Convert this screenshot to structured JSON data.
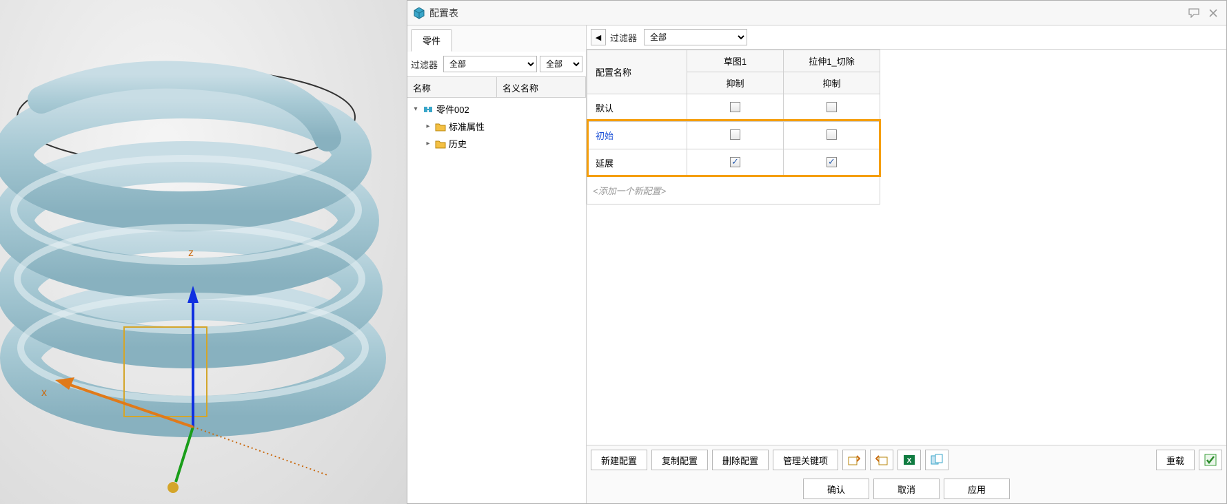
{
  "window": {
    "title": "配置表"
  },
  "left": {
    "tab_label": "零件",
    "filter_label": "过滤器",
    "filter1": "全部",
    "filter2": "全部",
    "header_name": "名称",
    "header_nominal": "名义名称",
    "tree": {
      "root": "零件002",
      "items": [
        "标准属性",
        "历史"
      ]
    }
  },
  "right": {
    "filter_label": "过滤器",
    "filter_value": "全部",
    "grid": {
      "col_config_name": "配置名称",
      "features": [
        {
          "name": "草图1",
          "param": "抑制"
        },
        {
          "name": "拉伸1_切除",
          "param": "抑制"
        }
      ],
      "rows": [
        {
          "name": "默认",
          "link": false,
          "suppress": [
            false,
            false
          ]
        },
        {
          "name": "初始",
          "link": true,
          "suppress": [
            false,
            false
          ]
        },
        {
          "name": "延展",
          "link": false,
          "suppress": [
            true,
            true
          ]
        }
      ],
      "add_placeholder": "<添加一个新配置>"
    },
    "actions": {
      "new_config": "新建配置",
      "copy_config": "复制配置",
      "delete_config": "删除配置",
      "manage_keys": "管理关键项",
      "reload": "重载"
    },
    "dialog": {
      "ok": "确认",
      "cancel": "取消",
      "apply": "应用"
    }
  }
}
